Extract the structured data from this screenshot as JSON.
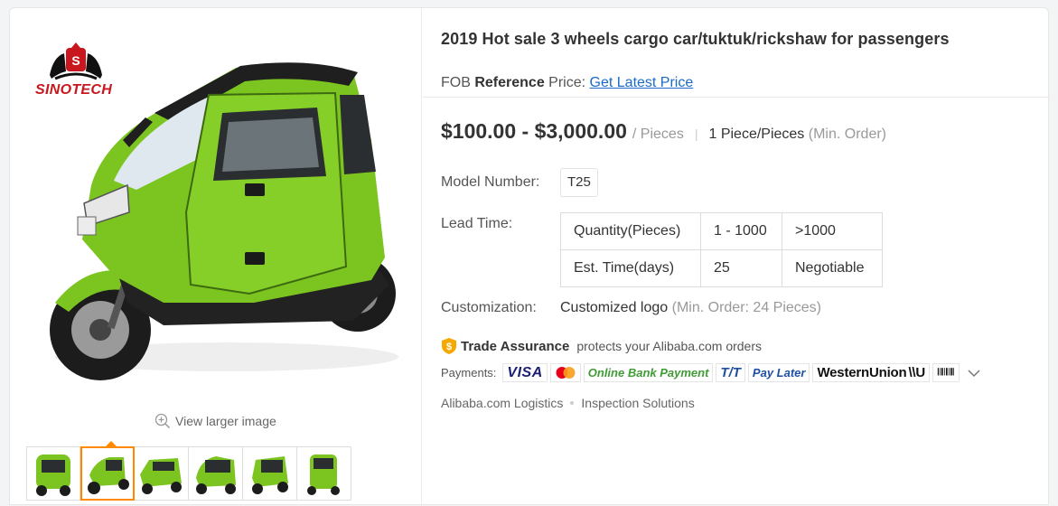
{
  "product": {
    "title": "2019 Hot sale 3 wheels cargo car/tuktuk/rickshaw for passengers",
    "brand_logo_text": "SINOTECH"
  },
  "fob": {
    "prefix": "FOB",
    "bold": "Reference",
    "suffix": "Price:",
    "link": "Get Latest Price"
  },
  "price": {
    "range": "$100.00 - $3,000.00",
    "unit": "/ Pieces",
    "separator": "|",
    "min_qty": "1 Piece/Pieces",
    "min_label": "(Min. Order)"
  },
  "model": {
    "label": "Model Number:",
    "value": "T25"
  },
  "lead_time": {
    "label": "Lead Time:",
    "rows": [
      [
        "Quantity(Pieces)",
        "1 - 1000",
        ">1000"
      ],
      [
        "Est. Time(days)",
        "25",
        "Negotiable"
      ]
    ]
  },
  "customization": {
    "label": "Customization:",
    "value": "Customized logo",
    "note": "(Min. Order: 24 Pieces)"
  },
  "trade_assurance": {
    "title": "Trade Assurance",
    "text": "protects your Alibaba.com orders",
    "icon": "shield-icon"
  },
  "payments": {
    "label": "Payments:",
    "methods": [
      "VISA",
      "Online Bank Payment",
      "T/T",
      "Pay Later",
      "WesternUnion",
      "Boleto"
    ]
  },
  "links": {
    "logistics": "Alibaba.com Logistics",
    "inspection": "Inspection Solutions"
  },
  "gallery": {
    "view_larger": "View larger image",
    "thumb_count": 6,
    "active_index": 1
  },
  "colors": {
    "vehicle_green": "#7cc520",
    "accent_orange": "#ff8a00",
    "link_blue": "#1a6bc6",
    "brand_red": "#c8171e"
  }
}
